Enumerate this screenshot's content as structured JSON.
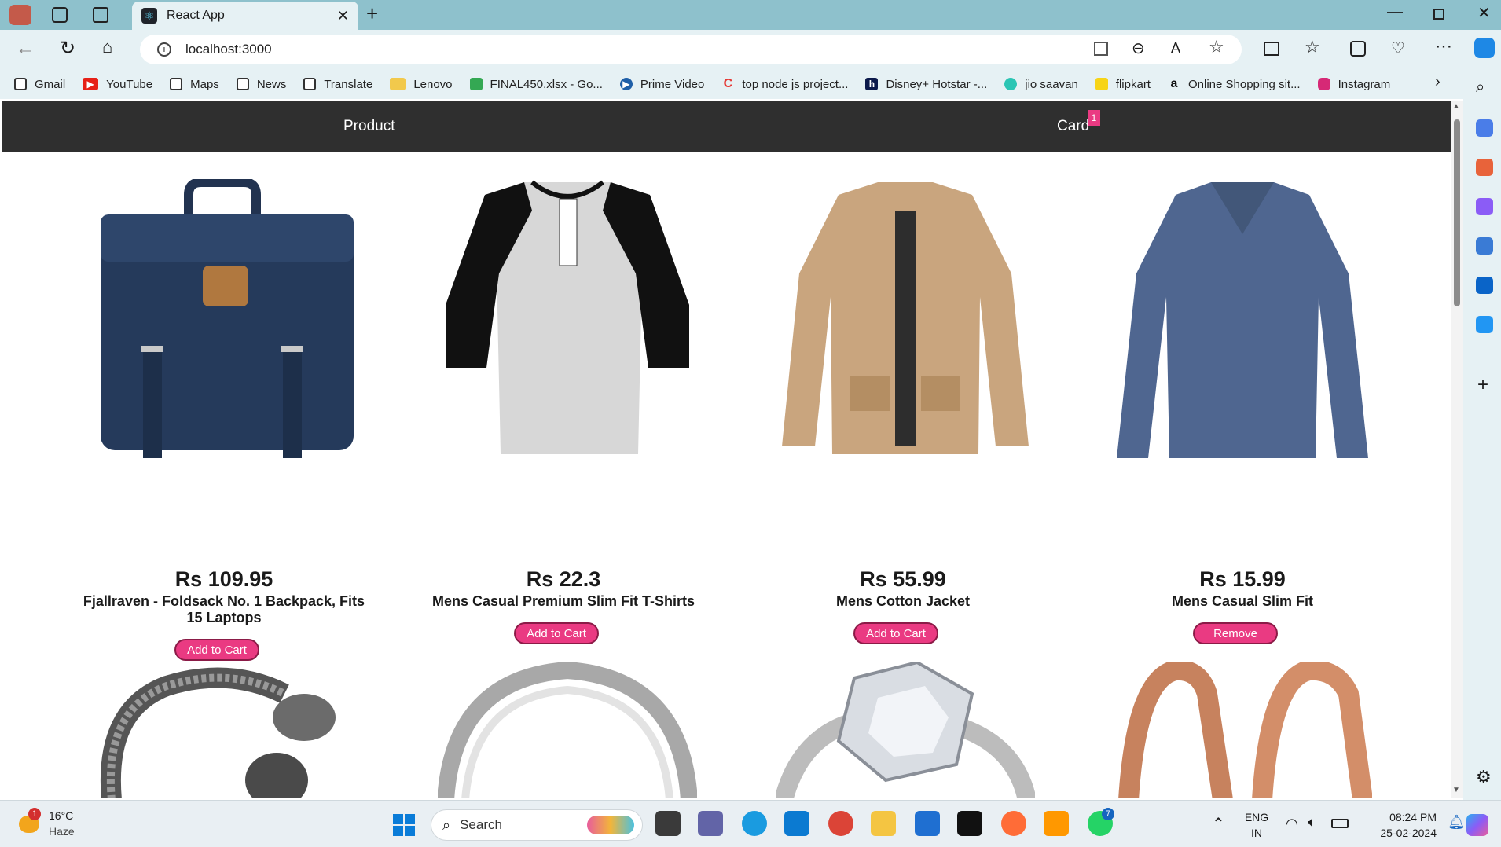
{
  "browser": {
    "tab_title": "React App",
    "url": "localhost:3000",
    "favorites": [
      "Gmail",
      "YouTube",
      "Maps",
      "News",
      "Translate",
      "Lenovo",
      "FINAL450.xlsx - Go...",
      "Prime Video",
      "top node js project...",
      "Disney+ Hotstar -...",
      "jio saavan",
      "flipkart",
      "Online Shopping sit...",
      "Instagram"
    ]
  },
  "nav": {
    "product": "Product",
    "cart": "Card",
    "cart_count": "1"
  },
  "products": [
    {
      "price": "Rs 109.95",
      "name": "Fjallraven - Foldsack No. 1 Backpack, Fits 15 Laptops",
      "button": "Add to Cart"
    },
    {
      "price": "Rs 22.3",
      "name": "Mens Casual Premium Slim Fit T-Shirts",
      "button": "Add to Cart"
    },
    {
      "price": "Rs 55.99",
      "name": "Mens Cotton Jacket",
      "button": "Add to Cart"
    },
    {
      "price": "Rs 15.99",
      "name": "Mens Casual Slim Fit",
      "button": "Remove"
    }
  ],
  "taskbar": {
    "weather_temp": "16°C",
    "weather_text": "Haze",
    "weather_alert": "1",
    "search": "Search",
    "lang1": "ENG",
    "lang2": "IN",
    "time": "08:24 PM",
    "date": "25-02-2024",
    "whatsapp_count": "7"
  },
  "colors": {
    "accent": "#ea3a82",
    "navbar": "#2f2f2f",
    "chrome": "#8ec1cc"
  }
}
